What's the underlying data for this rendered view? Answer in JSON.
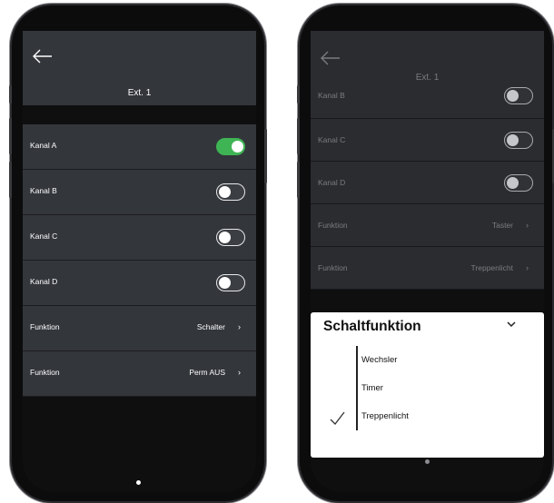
{
  "left_screen": {
    "title": "Ext. 1",
    "rows": [
      {
        "label": "Kanal A",
        "type": "toggle",
        "on": true
      },
      {
        "label": "Kanal B",
        "type": "toggle",
        "on": false
      },
      {
        "label": "Kanal C",
        "type": "toggle",
        "on": false
      },
      {
        "label": "Kanal D",
        "type": "toggle",
        "on": false
      },
      {
        "label": "Funktion",
        "type": "select",
        "value": "Schalter"
      },
      {
        "label": "Funktion",
        "type": "select",
        "value": "Perm AUS"
      }
    ]
  },
  "right_screen": {
    "title": "Ext. 1",
    "rows": [
      {
        "label": "Kanal B",
        "type": "toggle",
        "on": false
      },
      {
        "label": "Kanal C",
        "type": "toggle",
        "on": false
      },
      {
        "label": "Kanal D",
        "type": "toggle",
        "on": false
      },
      {
        "label": "Funktion",
        "type": "select",
        "value": "Taster"
      },
      {
        "label": "Funktion",
        "type": "select",
        "value": "Treppenlicht"
      }
    ],
    "sheet": {
      "title": "Schaltfunktion",
      "options": [
        "Wechsler",
        "Timer",
        "Treppenlicht"
      ],
      "selected": "Treppenlicht"
    }
  },
  "icons": {
    "back": "arrow-left-icon",
    "row_chevron": "chevron-right-icon",
    "sheet_collapse": "chevron-down-icon",
    "selected_mark": "checkmark-icon"
  },
  "colors": {
    "toggle_on": "#3fb454",
    "surface": "#33363b",
    "background": "#0f0f10"
  }
}
